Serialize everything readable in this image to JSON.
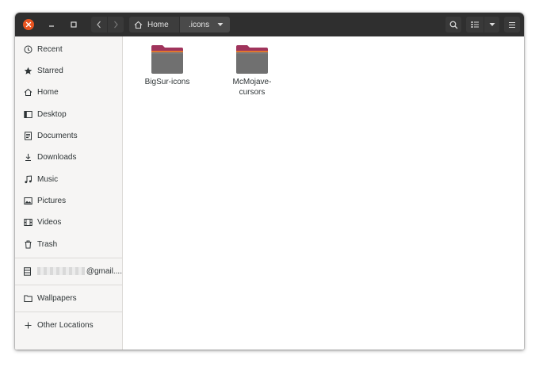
{
  "window": {
    "path": {
      "segments": [
        "Home",
        ".icons"
      ]
    }
  },
  "sidebar": {
    "items": [
      {
        "label": "Recent",
        "icon": "clock-icon"
      },
      {
        "label": "Starred",
        "icon": "star-icon"
      },
      {
        "label": "Home",
        "icon": "home-icon"
      },
      {
        "label": "Desktop",
        "icon": "desktop-icon"
      },
      {
        "label": "Documents",
        "icon": "document-icon"
      },
      {
        "label": "Downloads",
        "icon": "download-icon"
      },
      {
        "label": "Music",
        "icon": "music-icon"
      },
      {
        "label": "Pictures",
        "icon": "picture-icon"
      },
      {
        "label": "Videos",
        "icon": "video-icon"
      },
      {
        "label": "Trash",
        "icon": "trash-icon"
      }
    ],
    "account": {
      "label": "@gmail....",
      "icon": "server-icon"
    },
    "bookmark": {
      "label": "Wallpapers",
      "icon": "folder-icon"
    },
    "other": {
      "label": "Other Locations",
      "icon": "plus-icon"
    }
  },
  "files": [
    {
      "name": "BigSur-icons"
    },
    {
      "name": "McMojave-cursors"
    }
  ],
  "colors": {
    "accent": "#e95420",
    "headerbar": "#2f2f2f",
    "folder_body": "#707070",
    "folder_tab": "#a0345c",
    "folder_highlight": "#e0772f"
  }
}
